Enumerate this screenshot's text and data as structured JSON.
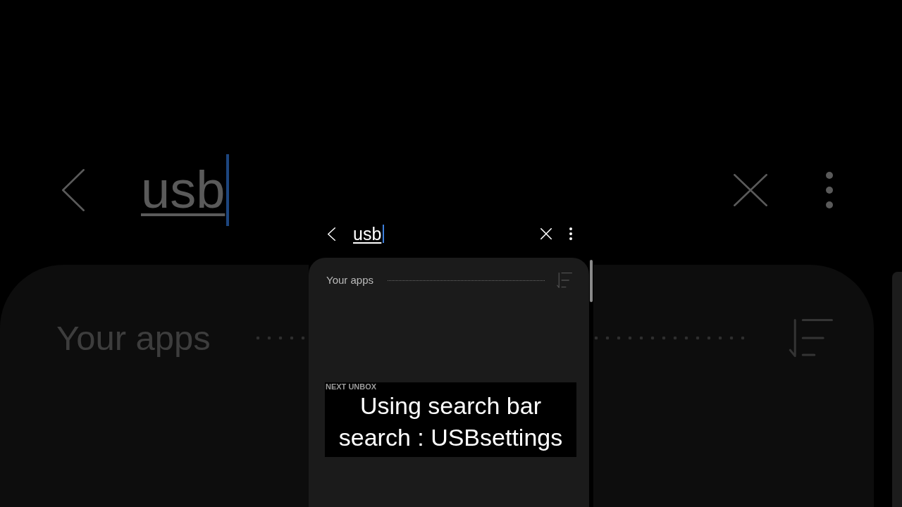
{
  "backdrop": {
    "search": {
      "value": "usb",
      "focused": true
    },
    "section_title": "Your apps"
  },
  "phone": {
    "search": {
      "value": "usb",
      "focused": true
    },
    "section_title": "Your apps"
  },
  "caption": {
    "label": "NEXT UNBOX",
    "lines": [
      "Using search bar",
      "search : USBsettings"
    ]
  }
}
